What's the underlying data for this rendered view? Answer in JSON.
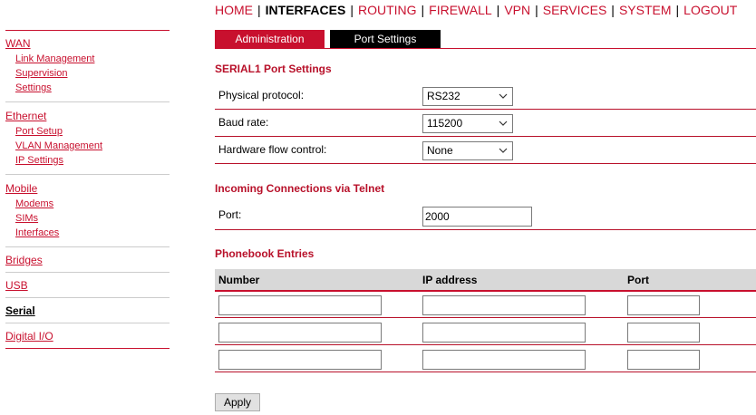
{
  "topnav": {
    "items": [
      "HOME",
      "INTERFACES",
      "ROUTING",
      "FIREWALL",
      "VPN",
      "SERVICES",
      "SYSTEM",
      "LOGOUT"
    ],
    "active": "INTERFACES",
    "separator": "|"
  },
  "sidebar": {
    "wan": {
      "title": "WAN",
      "items": [
        "Link Management",
        "Supervision",
        "Settings"
      ]
    },
    "ethernet": {
      "title": "Ethernet",
      "items": [
        "Port Setup",
        "VLAN Management",
        "IP Settings"
      ]
    },
    "mobile": {
      "title": "Mobile",
      "items": [
        "Modems",
        "SIMs",
        "Interfaces"
      ]
    },
    "bridges": "Bridges",
    "usb": "USB",
    "serial": "Serial",
    "digital_io": "Digital I/O"
  },
  "tabs": {
    "admin": "Administration",
    "port": "Port Settings"
  },
  "serial_section": {
    "title": "SERIAL1 Port Settings",
    "physical_protocol": {
      "label": "Physical protocol:",
      "value": "RS232"
    },
    "baud_rate": {
      "label": "Baud rate:",
      "value": "115200"
    },
    "flow_control": {
      "label": "Hardware flow control:",
      "value": "None"
    }
  },
  "telnet_section": {
    "title": "Incoming Connections via Telnet",
    "port_label": "Port:",
    "port_value": "2000"
  },
  "phonebook": {
    "title": "Phonebook Entries",
    "headers": [
      "Number",
      "IP address",
      "Port"
    ],
    "rows": [
      [
        "",
        "",
        ""
      ],
      [
        "",
        "",
        ""
      ],
      [
        "",
        "",
        ""
      ]
    ]
  },
  "apply_label": "Apply"
}
